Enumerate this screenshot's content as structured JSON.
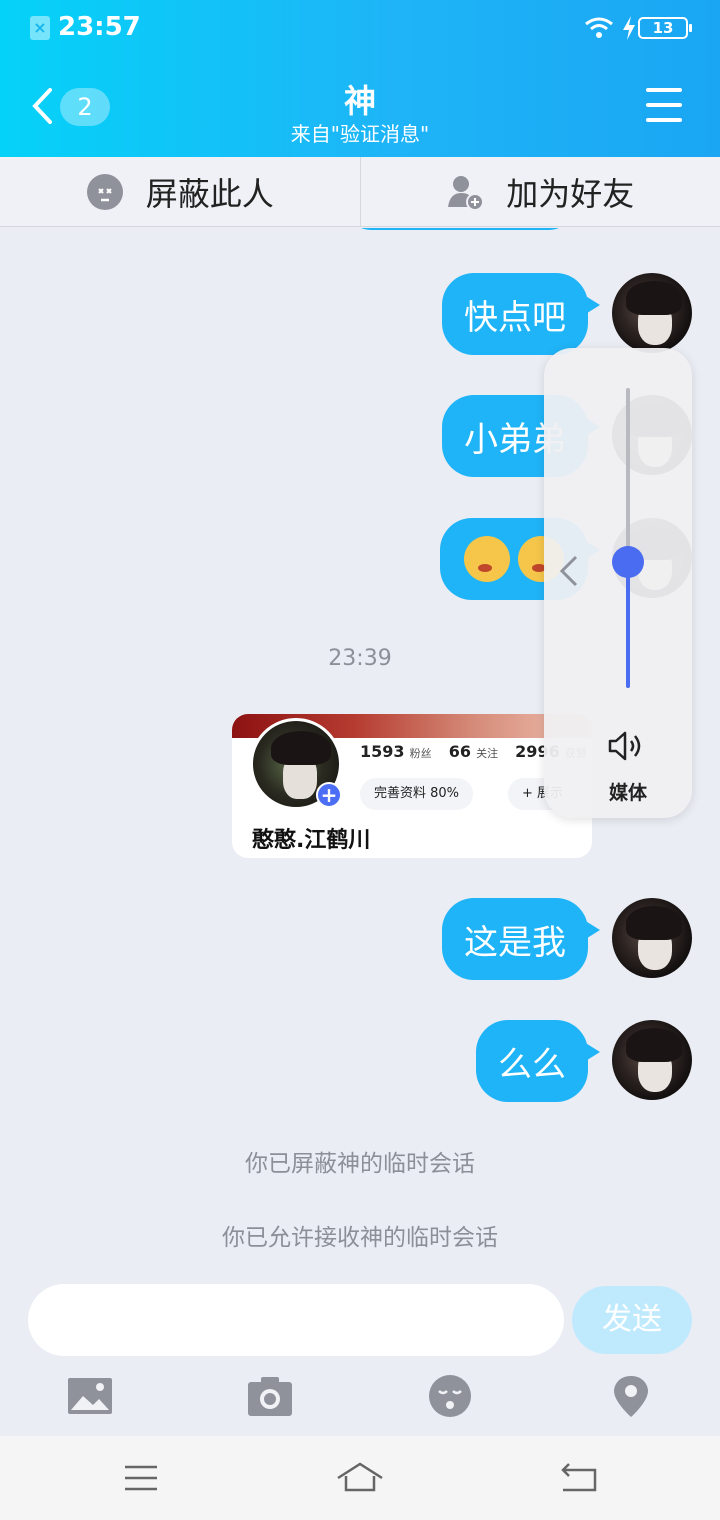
{
  "status_bar": {
    "time": "23:57",
    "battery": "13"
  },
  "header": {
    "back_badge": "2",
    "title": "神",
    "subtitle": "来自\"验证消息\""
  },
  "actions": {
    "block_label": "屏蔽此人",
    "add_friend_label": "加为好友"
  },
  "messages": {
    "m1": "快点吧",
    "m2": "小弟弟",
    "timestamp": "23:39",
    "m4": "这是我",
    "m5": "么么"
  },
  "profile_card": {
    "fans": "1593",
    "fans_label": "粉丝",
    "following": "66",
    "following_label": "关注",
    "likes": "2996",
    "likes_label": "获赞",
    "edit_btn": "完善资料 80%",
    "second_btn": "+ 展示",
    "name": "憨憨.江鹤川"
  },
  "system_messages": {
    "s1": "你已屏蔽神的临时会话",
    "s2": "你已允许接收神的临时会话"
  },
  "input": {
    "placeholder": "",
    "send_label": "发送"
  },
  "volume_panel": {
    "label": "媒体",
    "level": 0.42
  },
  "icons": [
    "sim-icon",
    "wifi-icon",
    "charge-icon",
    "back-icon",
    "menu-icon",
    "block-icon",
    "add-friend-icon",
    "image-icon",
    "camera-icon",
    "emoji-icon",
    "location-icon",
    "nav-menu-icon",
    "nav-home-icon",
    "nav-back-icon",
    "speaker-icon",
    "chevron-left-icon"
  ],
  "colors": {
    "accent": "#1fb4f7",
    "volume": "#4a6cf0",
    "send_disabled": "#bfeafd"
  }
}
